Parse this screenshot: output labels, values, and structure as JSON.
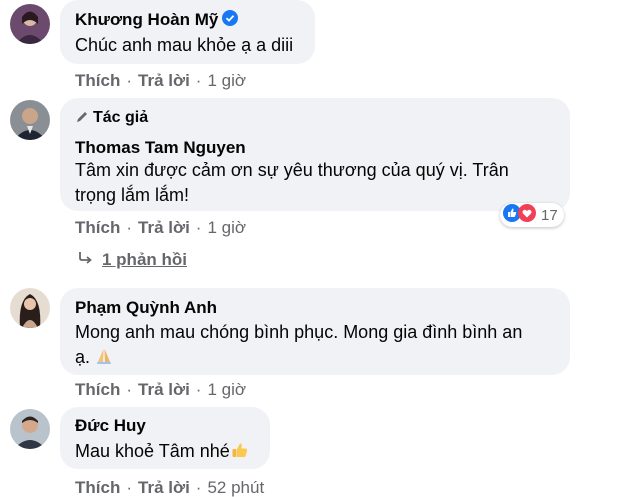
{
  "comments": [
    {
      "author": "Khương Hoàn Mỹ",
      "verified": true,
      "text": "Chúc anh mau khỏe ạ a diii",
      "actions": {
        "like": "Thích",
        "reply": "Trả lời",
        "time": "1 giờ"
      }
    },
    {
      "author_tag": "Tác giả",
      "author": "Thomas Tam Nguyen",
      "text_line1": "Tâm xin được cảm ơn sự yêu thương của quý vị. Trân",
      "text_line2": "trọng lắm lắm!",
      "reaction_count": "17",
      "actions": {
        "like": "Thích",
        "reply": "Trả lời",
        "time": "1 giờ"
      },
      "replies_label": "1 phản hồi"
    },
    {
      "author": "Phạm Quỳnh Anh",
      "text_line1": "Mong anh mau chóng bình phục. Mong gia đình bình an",
      "text_line2": "ạ.",
      "actions": {
        "like": "Thích",
        "reply": "Trả lời",
        "time": "1 giờ"
      }
    },
    {
      "author": "Đức Huy",
      "text": "Mau khoẻ Tâm nhé",
      "actions": {
        "like": "Thích",
        "reply": "Trả lời",
        "time": "52 phút"
      }
    }
  ],
  "colors": {
    "bubble": "#f0f2f5",
    "meta": "#65676b",
    "verified": "#1877f2",
    "like": "#1877f2",
    "love": "#f33e58"
  }
}
